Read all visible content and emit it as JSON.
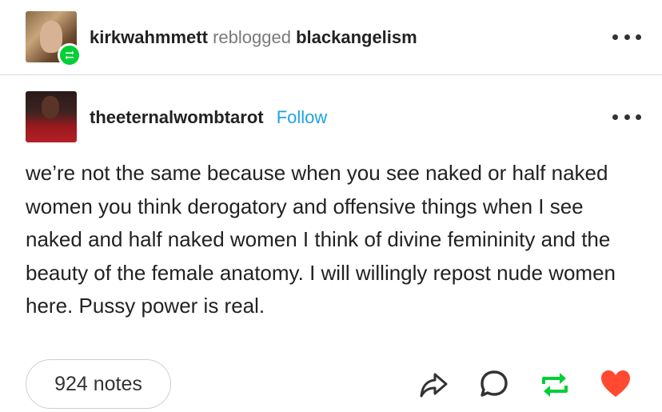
{
  "reblog_header": {
    "reblogger": "kirkwahmmett",
    "verb": "reblogged",
    "source": "blackangelism"
  },
  "post": {
    "author": "theeternalwombtarot",
    "follow_label": "Follow",
    "text": "we’re not the same because when you see naked or half naked women you think derogatory and offensive things when I see naked and half naked women I think of divine femininity and the beauty of the female anatomy. I will willingly repost nude women here. Pussy power is real."
  },
  "footer": {
    "notes_label": "924 notes"
  },
  "icons": {
    "reblog_badge": "reblog-icon",
    "more": "more-options-icon",
    "share": "share-icon",
    "reply": "reply-icon",
    "reblog": "reblog-icon",
    "like": "heart-icon"
  },
  "colors": {
    "follow": "#1fa3e0",
    "reblog_green": "#00cf35",
    "like_red": "#ff4930"
  }
}
